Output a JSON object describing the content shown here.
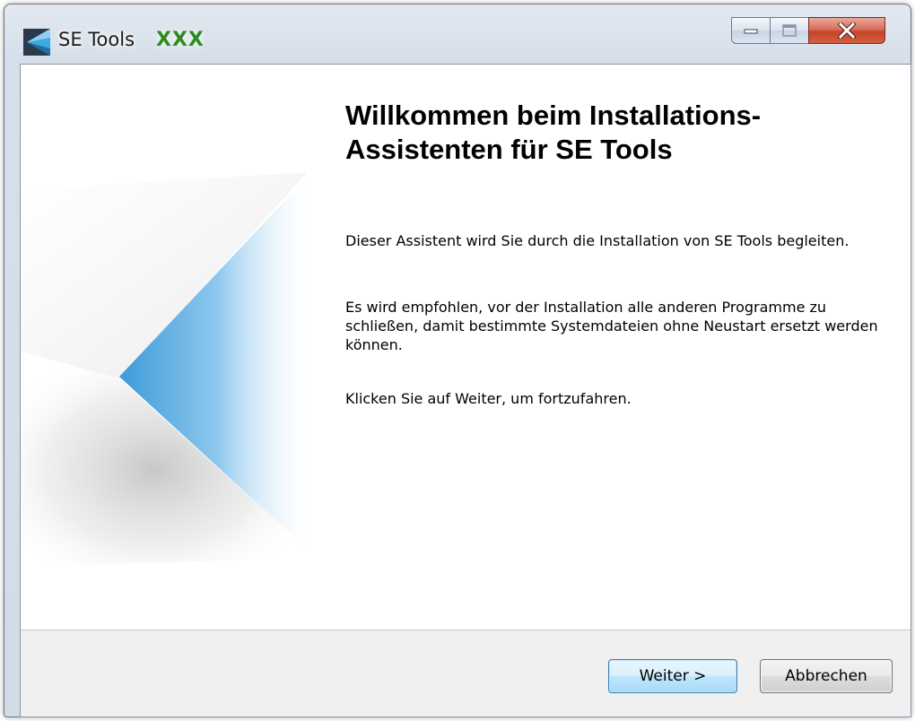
{
  "window": {
    "title": "SE Tools",
    "badge": "XXX",
    "icon": "se-tools-logo-icon"
  },
  "title_controls": {
    "minimize_icon": "minimize-icon",
    "maximize_icon": "maximize-icon",
    "close_icon": "close-icon",
    "close_color": "#c4432a"
  },
  "welcome": {
    "heading": "Willkommen beim Installations-Assistenten für SE Tools",
    "paragraph1": "Dieser Assistent wird Sie durch die Installation von SE Tools begleiten.",
    "paragraph2": "Es wird empfohlen, vor der Installation alle anderen Programme zu schließen, damit bestimmte Systemdateien ohne Neustart ersetzt werden können.",
    "paragraph3": "Klicken Sie auf Weiter, um fortzufahren."
  },
  "buttons": {
    "next_label": "Weiter >",
    "cancel_label": "Abbrechen"
  },
  "colors": {
    "accent_blue": "#4a9fd8",
    "badge_green": "#2e8b1e"
  }
}
